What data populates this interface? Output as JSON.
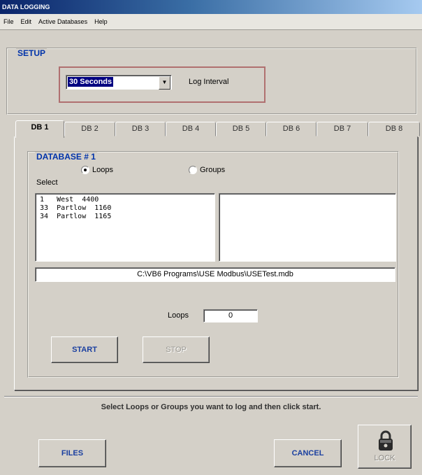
{
  "window": {
    "title": "DATA LOGGING"
  },
  "menu": [
    "File",
    "Edit",
    "Active Databases",
    "Help"
  ],
  "setup": {
    "title": "SETUP",
    "interval_value": "30 Seconds",
    "interval_label": "Log Interval"
  },
  "tabs": [
    {
      "label": "DB 1",
      "active": true
    },
    {
      "label": "DB 2"
    },
    {
      "label": "DB 3"
    },
    {
      "label": "DB 4"
    },
    {
      "label": "DB 5"
    },
    {
      "label": "DB 6"
    },
    {
      "label": "DB 7"
    },
    {
      "label": "DB 8"
    }
  ],
  "database": {
    "title": "DATABASE # 1",
    "radio_loops": "Loops",
    "radio_groups": "Groups",
    "selected_mode": "Loops",
    "select_label": "Select",
    "available": [
      "1   West  4400",
      "33  Partlow  1160",
      "34  Partlow  1165"
    ],
    "selected": [],
    "path": "C:\\VB6 Programs\\USE Modbus\\USETest.mdb",
    "loops_label": "Loops",
    "loops_count": "0",
    "start_label": "START",
    "stop_label": "STOP"
  },
  "hint": "Select Loops or Groups you want to log and then click start.",
  "footer": {
    "files_label": "FILES",
    "cancel_label": "CANCEL",
    "lock_label": "LOCK"
  },
  "colors": {
    "title_blue": "#0033aa",
    "button_text": "#1a3fa0",
    "frame_red": "#b07070",
    "selection": "#000080"
  }
}
